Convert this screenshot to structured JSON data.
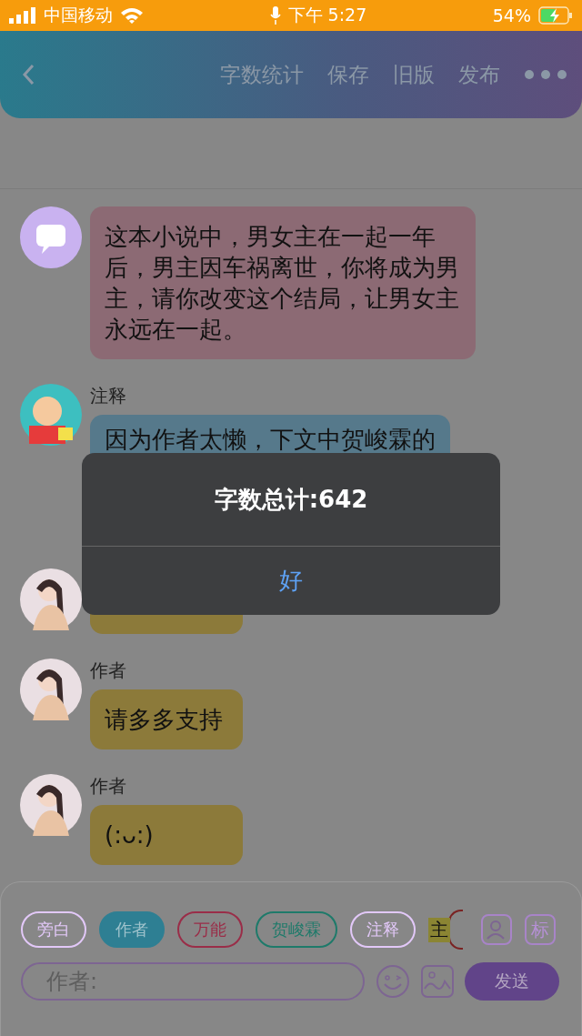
{
  "status_bar": {
    "carrier": "中国移动",
    "time": "下午 5:27",
    "battery": "54%"
  },
  "header": {
    "actions": [
      "字数统计",
      "保存",
      "旧版",
      "发布"
    ]
  },
  "messages": [
    {
      "kind": "bot",
      "text": "这本小说中，男女主在一起一年后，男主因车祸离世，你将成为男主，请你改变这个结局，让男女主永远在一起。",
      "color": "#8c6a74"
    },
    {
      "kind": "cartoon",
      "name": "注释",
      "text": "因为作者太懒，下文中贺峻霖的",
      "color": "#56798b"
    },
    {
      "kind": "woman",
      "color": "#8c7a3a"
    },
    {
      "kind": "woman",
      "name": "作者",
      "text": "请多多支持",
      "color": "#8c7a3a"
    },
    {
      "kind": "woman",
      "name": "作者",
      "text": "(:ᴗ:)",
      "color": "#8c7a3a"
    }
  ],
  "roles": [
    {
      "label": "旁白",
      "color": "#e2c8f8",
      "selected": false
    },
    {
      "label": "作者",
      "color": "#2e7f93",
      "selected": true
    },
    {
      "label": "万能",
      "color": "#9a2d48",
      "selected": false
    },
    {
      "label": "贺峻霖",
      "color": "#1e7a6a",
      "selected": false
    },
    {
      "label": "注释",
      "color": "#e2c8f8",
      "selected": false
    }
  ],
  "marker": "主",
  "tag_button": "标",
  "composer": {
    "placeholder": "作者:",
    "send": "发送"
  },
  "alert": {
    "title": "字数总计:642",
    "button": "好"
  }
}
